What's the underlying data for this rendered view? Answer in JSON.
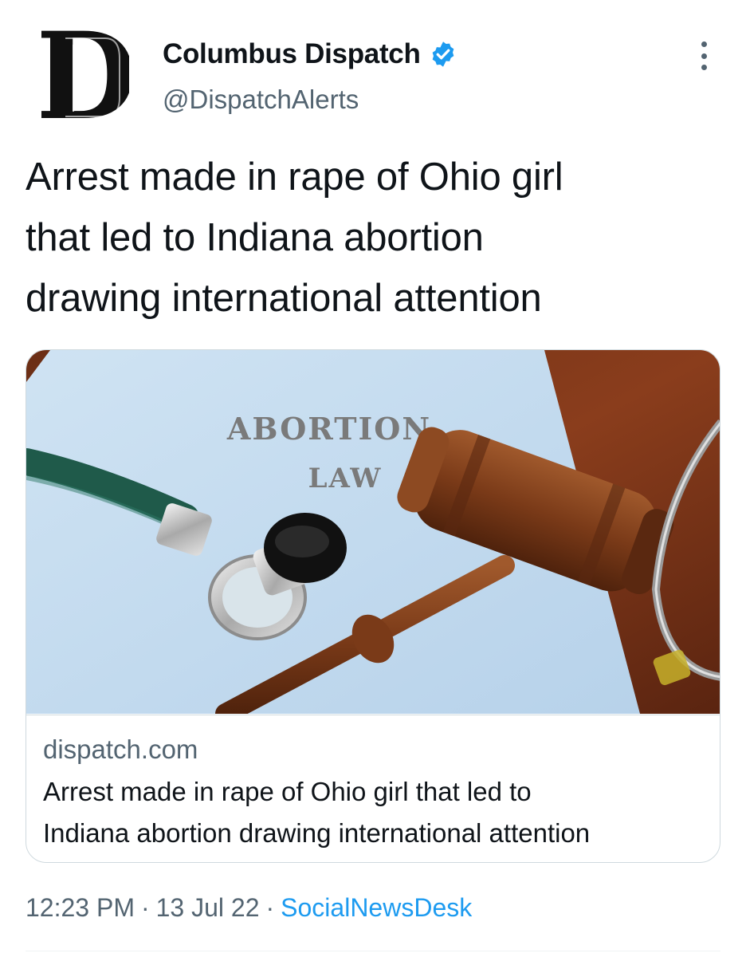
{
  "author": {
    "name": "Columbus Dispatch",
    "handle": "@DispatchAlerts",
    "verified": true,
    "avatar_icon": "gothic-d-logo",
    "avatar_letter": "D"
  },
  "tweet": {
    "text_lines": [
      "Arrest made in rape of Ohio girl",
      "that led to Indiana abortion",
      "drawing international attention"
    ]
  },
  "card": {
    "image_text_line1": "ABORTION",
    "image_text_line2": "LAW",
    "domain": "dispatch.com",
    "title_line1": "Arrest made in rape of Ohio girl that led to",
    "title_line2": "Indiana abortion drawing international attention"
  },
  "meta": {
    "time": "12:23 PM",
    "separator": "·",
    "date": "13 Jul 22",
    "source": "SocialNewsDesk"
  },
  "colors": {
    "text": "#0f1419",
    "secondary": "#536471",
    "link": "#1d9bf0",
    "border": "#cfd9de"
  },
  "icons": {
    "verified": "verified-badge-icon",
    "more": "more-options-icon"
  }
}
